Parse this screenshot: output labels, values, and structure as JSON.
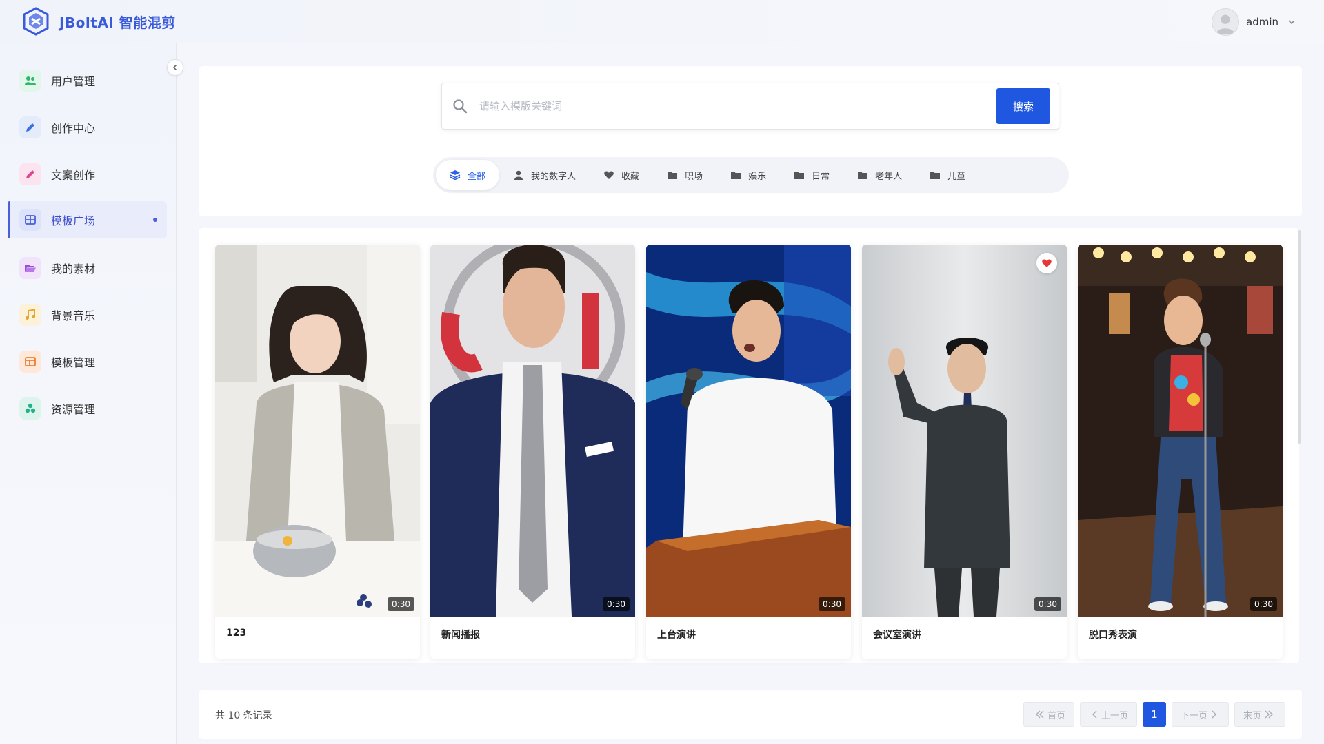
{
  "header": {
    "app_title": "JBoltAI 智能混剪",
    "user_name": "admin"
  },
  "sidebar": {
    "items": [
      {
        "label": "用户管理",
        "icon": "users-icon",
        "color": "#2fb86a"
      },
      {
        "label": "创作中心",
        "icon": "pen-icon",
        "color": "#3a6ee8"
      },
      {
        "label": "文案创作",
        "icon": "edit-icon",
        "color": "#e0458f"
      },
      {
        "label": "模板广场",
        "icon": "grid-icon",
        "color": "#4a5fd9",
        "active": true
      },
      {
        "label": "我的素材",
        "icon": "folder-open-icon",
        "color": "#9b4fd6"
      },
      {
        "label": "背景音乐",
        "icon": "music-icon",
        "color": "#e6a52b"
      },
      {
        "label": "模板管理",
        "icon": "layout-icon",
        "color": "#f07c2a"
      },
      {
        "label": "资源管理",
        "icon": "cubes-icon",
        "color": "#26b08a"
      }
    ]
  },
  "search": {
    "placeholder": "请输入模版关键词",
    "value": "",
    "button_label": "搜索"
  },
  "filters": [
    {
      "label": "全部",
      "icon": "layers-icon",
      "active": true
    },
    {
      "label": "我的数字人",
      "icon": "user-icon"
    },
    {
      "label": "收藏",
      "icon": "heart-icon"
    },
    {
      "label": "职场",
      "icon": "folder-icon"
    },
    {
      "label": "娱乐",
      "icon": "folder-icon"
    },
    {
      "label": "日常",
      "icon": "folder-icon"
    },
    {
      "label": "老年人",
      "icon": "folder-icon"
    },
    {
      "label": "儿童",
      "icon": "folder-icon"
    }
  ],
  "cards": [
    {
      "title": "123",
      "duration": "0:30",
      "favorited": false
    },
    {
      "title": "新闻播报",
      "duration": "0:30",
      "favorited": false
    },
    {
      "title": "上台演讲",
      "duration": "0:30",
      "favorited": false
    },
    {
      "title": "会议室演讲",
      "duration": "0:30",
      "favorited": true
    },
    {
      "title": "脱口秀表演",
      "duration": "0:30",
      "favorited": false
    }
  ],
  "pagination": {
    "total_text": "共 10 条记录",
    "first": "首页",
    "prev": "上一页",
    "current": "1",
    "next": "下一页",
    "last": "末页"
  },
  "colors": {
    "accent": "#1f57e0",
    "brand": "#3a5bd9",
    "favorite": "#e53935"
  }
}
